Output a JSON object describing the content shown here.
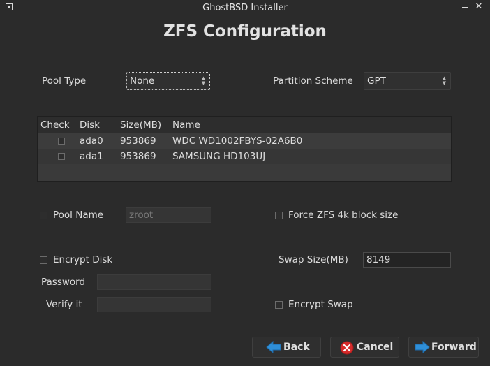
{
  "window": {
    "title": "GhostBSD Installer",
    "close_glyph": "✕"
  },
  "page": {
    "title": "ZFS Configuration"
  },
  "pool_type": {
    "label": "Pool Type",
    "value": "None"
  },
  "partition_scheme": {
    "label": "Partition Scheme",
    "value": "GPT"
  },
  "disk_table": {
    "headers": [
      "Check",
      "Disk",
      "Size(MB)",
      "Name"
    ],
    "rows": [
      {
        "disk": "ada0",
        "size": "953869",
        "name": "WDC WD1002FBYS-02A6B0",
        "checked": false
      },
      {
        "disk": "ada1",
        "size": "953869",
        "name": "SAMSUNG HD103UJ",
        "checked": false
      }
    ]
  },
  "pool_name": {
    "label": "Pool Name",
    "value": "zroot",
    "checked": false
  },
  "force_4k": {
    "label": "Force ZFS 4k block size",
    "checked": false
  },
  "encrypt_disk": {
    "label": "Encrypt Disk",
    "checked": false
  },
  "password": {
    "label": "Password",
    "value": ""
  },
  "verify": {
    "label": "Verify it",
    "value": ""
  },
  "swap_size": {
    "label": "Swap Size(MB)",
    "value": "8149"
  },
  "encrypt_swap": {
    "label": "Encrypt Swap",
    "checked": false
  },
  "buttons": {
    "back": "Back",
    "cancel": "Cancel",
    "forward": "Forward"
  },
  "colors": {
    "back_icon": "#2f8fd8",
    "forward_icon": "#2f8fd8",
    "cancel_icon": "#d62b2b"
  }
}
